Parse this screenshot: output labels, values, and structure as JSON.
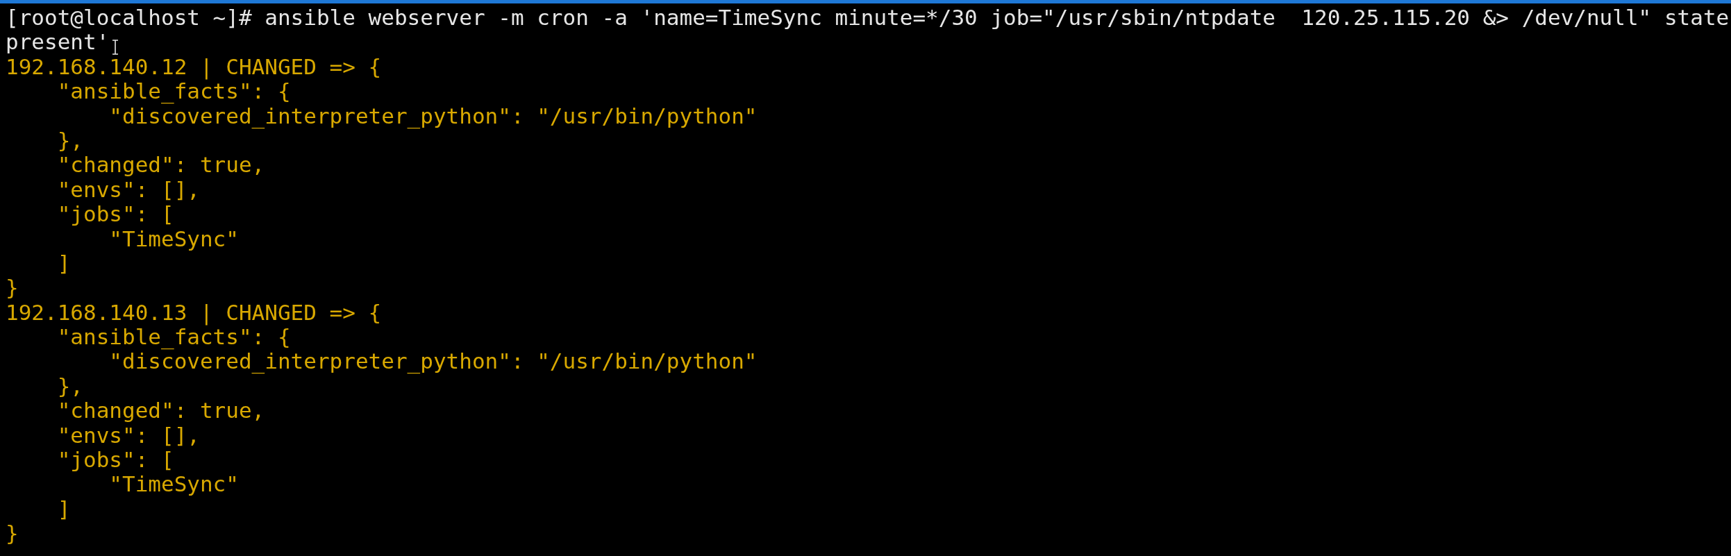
{
  "terminal": {
    "lines": [
      {
        "kind": "command",
        "text": "[root@localhost ~]# ansible webserver -m cron -a 'name=TimeSync minute=*/30 job=\"/usr/sbin/ntpdate  120.25.115.20 &> /dev/null\" state"
      },
      {
        "kind": "command",
        "text": "present'",
        "pointer": true
      },
      {
        "kind": "output",
        "text": "192.168.140.12 | CHANGED => {"
      },
      {
        "kind": "output",
        "text": "    \"ansible_facts\": {"
      },
      {
        "kind": "output",
        "text": "        \"discovered_interpreter_python\": \"/usr/bin/python\""
      },
      {
        "kind": "output",
        "text": "    },"
      },
      {
        "kind": "output",
        "text": "    \"changed\": true,"
      },
      {
        "kind": "output",
        "text": "    \"envs\": [],"
      },
      {
        "kind": "output",
        "text": "    \"jobs\": ["
      },
      {
        "kind": "output",
        "text": "        \"TimeSync\""
      },
      {
        "kind": "output",
        "text": "    ]"
      },
      {
        "kind": "output",
        "text": "}"
      },
      {
        "kind": "output",
        "text": "192.168.140.13 | CHANGED => {"
      },
      {
        "kind": "output",
        "text": "    \"ansible_facts\": {"
      },
      {
        "kind": "output",
        "text": "        \"discovered_interpreter_python\": \"/usr/bin/python\""
      },
      {
        "kind": "output",
        "text": "    },"
      },
      {
        "kind": "output",
        "text": "    \"changed\": true,"
      },
      {
        "kind": "output",
        "text": "    \"envs\": [],"
      },
      {
        "kind": "output",
        "text": "    \"jobs\": ["
      },
      {
        "kind": "output",
        "text": "        \"TimeSync\""
      },
      {
        "kind": "output",
        "text": "    ]"
      },
      {
        "kind": "output",
        "text": "}"
      }
    ]
  }
}
